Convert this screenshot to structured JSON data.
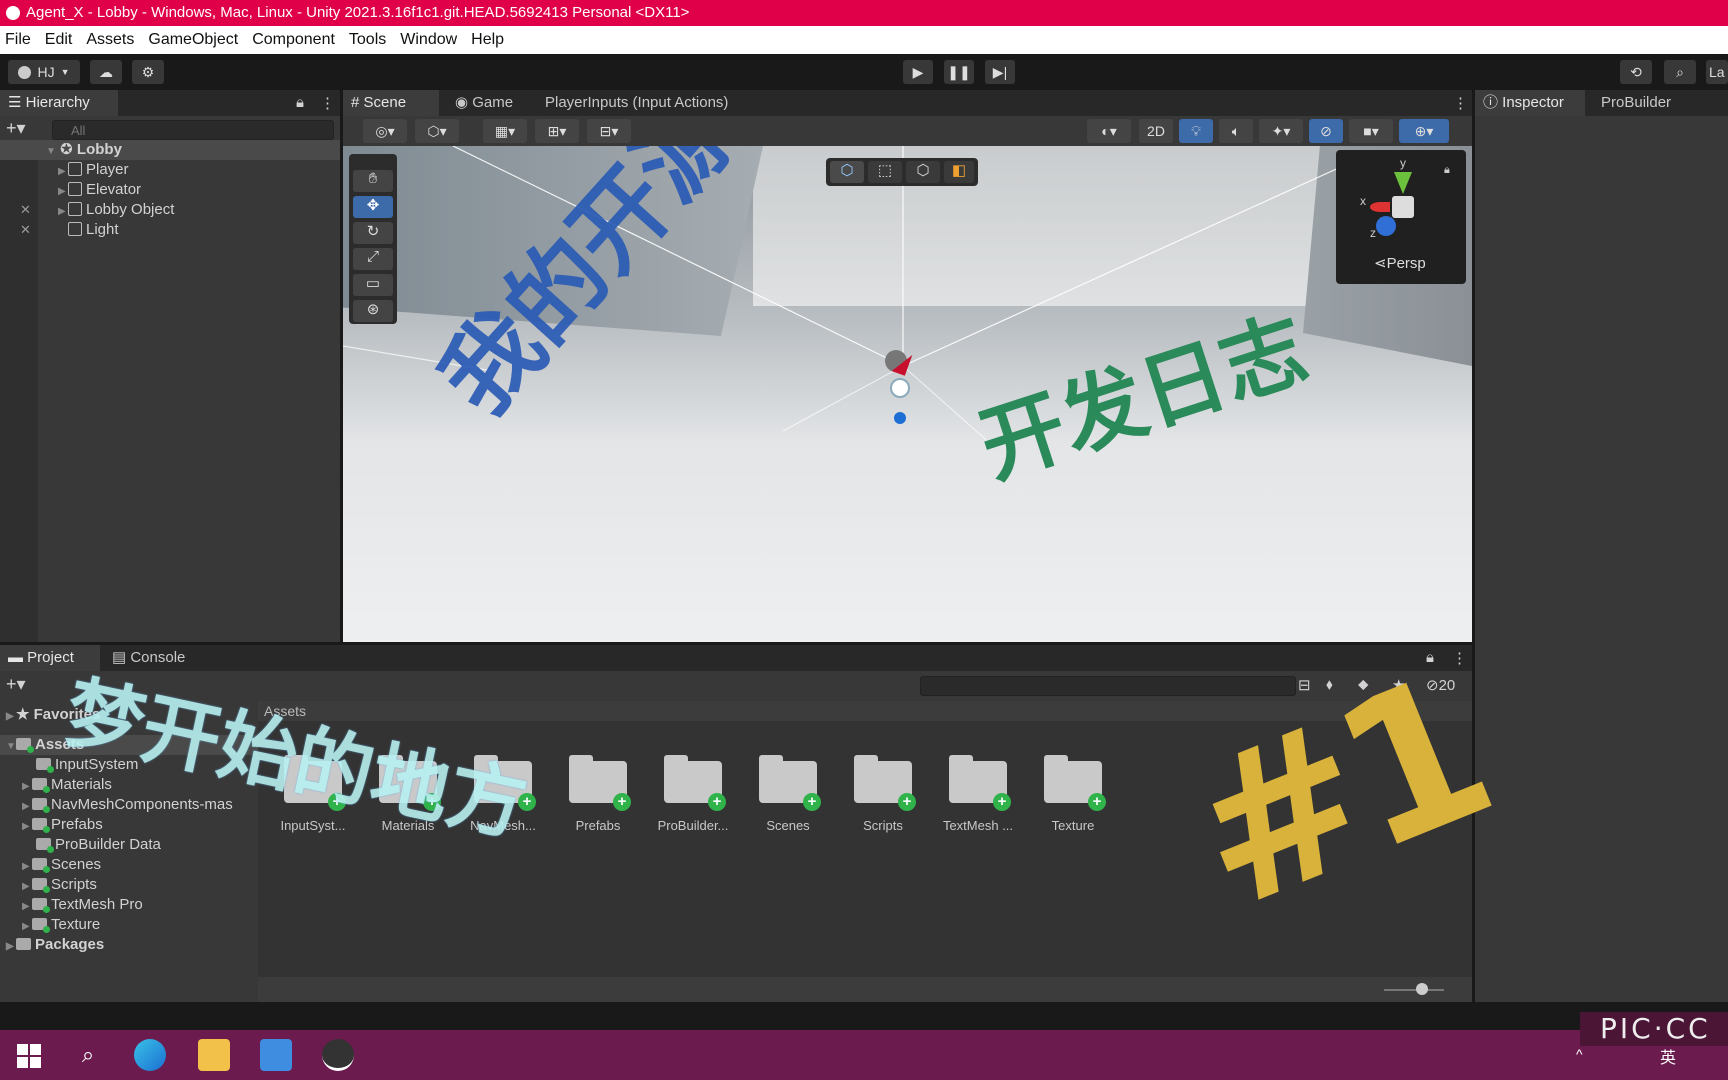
{
  "window": {
    "title": "Agent_X - Lobby - Windows, Mac, Linux - Unity 2021.3.16f1c1.git.HEAD.5692413 Personal <DX11>"
  },
  "menu": [
    "File",
    "Edit",
    "Assets",
    "GameObject",
    "Component",
    "Tools",
    "Window",
    "Help"
  ],
  "toolbar": {
    "account": "HJ",
    "layers_label": "La"
  },
  "hierarchy": {
    "tab": "Hierarchy",
    "search_placeholder": "All",
    "scene_name": "Lobby",
    "items": [
      "Player",
      "Elevator",
      "Lobby Object",
      "Light"
    ]
  },
  "scene_tabs": [
    "Scene",
    "Game",
    "PlayerInputs (Input Actions)"
  ],
  "scene_toolbar": {
    "mode_2d": "2D",
    "gizmo_label": "Persp",
    "gizmo_axes": [
      "y",
      "x",
      "z"
    ]
  },
  "inspector_tabs": [
    "Inspector",
    "ProBuilder"
  ],
  "project": {
    "tabs": [
      "Project",
      "Console"
    ],
    "favorites": "Favorites",
    "assets_root": "Assets",
    "breadcrumb": "Assets",
    "tree": [
      "InputSystem",
      "Materials",
      "NavMeshComponents-mas",
      "Prefabs",
      "ProBuilder Data",
      "Scenes",
      "Scripts",
      "TextMesh Pro",
      "Texture"
    ],
    "packages": "Packages",
    "grid": [
      "InputSyst...",
      "Materials",
      "NavMesh...",
      "Prefabs",
      "ProBuilder...",
      "Scenes",
      "Scripts",
      "TextMesh ...",
      "Texture"
    ],
    "hidden_count": "20"
  },
  "overlay": {
    "text_blue": "我的开源",
    "text_green": "开发日志",
    "text_cyan": "梦开始的地方",
    "text_gold": "#1",
    "watermark": "PIC·CC"
  },
  "taskbar": {
    "ime": "英"
  },
  "colors": {
    "titlebar": "#e0004a",
    "panel": "#383838",
    "taskbar": "#6b1b4d",
    "accent_green": "#2fb34a"
  }
}
